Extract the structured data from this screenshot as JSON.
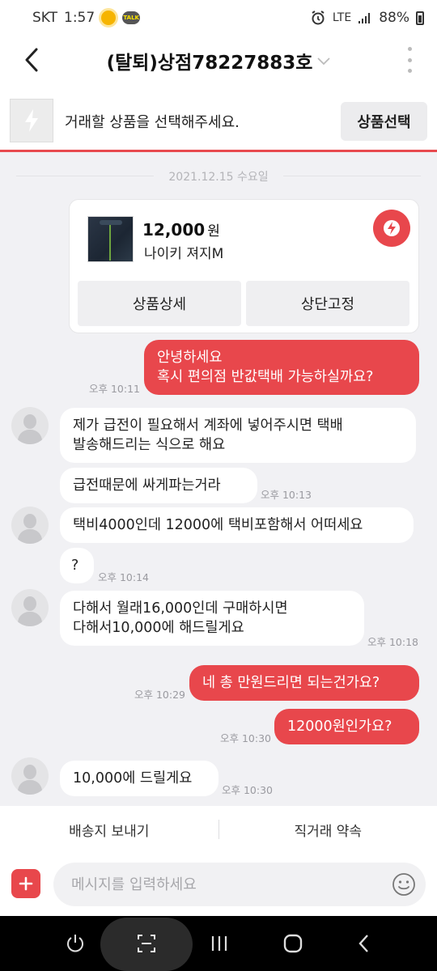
{
  "status_bar": {
    "carrier": "SKT",
    "time": "1:57",
    "network": "LTE",
    "battery": "88%"
  },
  "header": {
    "title": "(탈퇴)상점78227883호"
  },
  "product_bar": {
    "prompt": "거래할 상품을 선택해주세요.",
    "select_button": "상품선택"
  },
  "chat": {
    "date": "2021.12.15 수요일",
    "product_card": {
      "price": "12,000",
      "currency": "원",
      "name": "나이키 져지M",
      "detail_button": "상품상세",
      "pin_button": "상단고정"
    },
    "messages": [
      {
        "sender": "me",
        "lines": [
          "안녕하세요",
          "혹시 편의점 반값택배 가능하실까요?"
        ],
        "time": "오후 10:11"
      },
      {
        "sender": "them",
        "lines": [
          "제가 급전이 필요해서 계좌에 넣어주시면 택배",
          "발송해드리는 식으로 해요"
        ],
        "time": ""
      },
      {
        "sender": "them",
        "lines": [
          "급전때문에 싸게파는거라"
        ],
        "time": "오후 10:13"
      },
      {
        "sender": "them",
        "lines": [
          "택비4000인데 12000에 택비포함해서 어떠세요"
        ],
        "time": ""
      },
      {
        "sender": "them",
        "lines": [
          "?"
        ],
        "time": "오후 10:14"
      },
      {
        "sender": "them",
        "lines": [
          "다해서 월래16,000인데 구매하시면",
          "다해서10,000에 해드릴게요"
        ],
        "time": "오후 10:18"
      },
      {
        "sender": "me",
        "lines": [
          "네 총 만원드리면 되는건가요?"
        ],
        "time": "오후 10:29"
      },
      {
        "sender": "me",
        "lines": [
          "12000원인가요?"
        ],
        "time": "오후 10:30"
      },
      {
        "sender": "them",
        "lines": [
          "10,000에 드릴게요"
        ],
        "time": "오후 10:30"
      }
    ]
  },
  "actions": {
    "send_address": "배송지 보내기",
    "direct_trade": "직거래 약속"
  },
  "input": {
    "placeholder": "메시지를 입력하세요"
  },
  "colors": {
    "accent": "#e8474c",
    "background": "#f1f1f4"
  }
}
